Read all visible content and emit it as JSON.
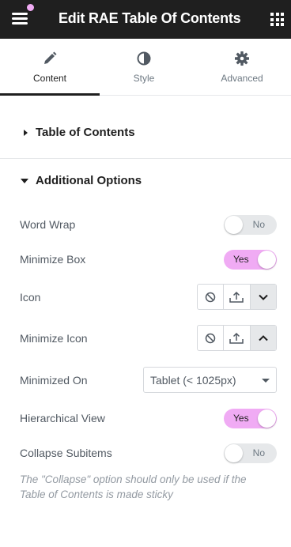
{
  "header": {
    "title": "Edit RAE Table Of Contents",
    "menu_icon": "hamburger-menu-icon",
    "apps_icon": "grid-icon",
    "notification_color": "#f0abf4"
  },
  "tabs": [
    {
      "label": "Content",
      "icon": "pencil-icon",
      "active": true
    },
    {
      "label": "Style",
      "icon": "half-circle-icon",
      "active": false
    },
    {
      "label": "Advanced",
      "icon": "gear-icon",
      "active": false
    }
  ],
  "sections": {
    "toc": {
      "title": "Table of Contents",
      "expanded": false
    },
    "additional": {
      "title": "Additional Options",
      "expanded": true
    }
  },
  "controls": {
    "word_wrap": {
      "label": "Word Wrap",
      "value": "No"
    },
    "minimize_box": {
      "label": "Minimize Box",
      "value": "Yes"
    },
    "icon": {
      "label": "Icon",
      "buttons": [
        "ban-icon",
        "upload-icon",
        "chevron-down-icon"
      ]
    },
    "minimize_icon": {
      "label": "Minimize Icon",
      "buttons": [
        "ban-icon",
        "upload-icon",
        "chevron-up-icon"
      ]
    },
    "minimized_on": {
      "label": "Minimized On",
      "value": "Tablet (< 1025px)"
    },
    "hierarchical_view": {
      "label": "Hierarchical View",
      "value": "Yes"
    },
    "collapse_subitems": {
      "label": "Collapse Subitems",
      "value": "No"
    }
  },
  "note": "The \"Collapse\" option should only be used if the Table of Contents is made sticky",
  "colors": {
    "toggle_on": "#f0abf4",
    "header_bg": "#1f1f1f",
    "text": "#515962"
  }
}
